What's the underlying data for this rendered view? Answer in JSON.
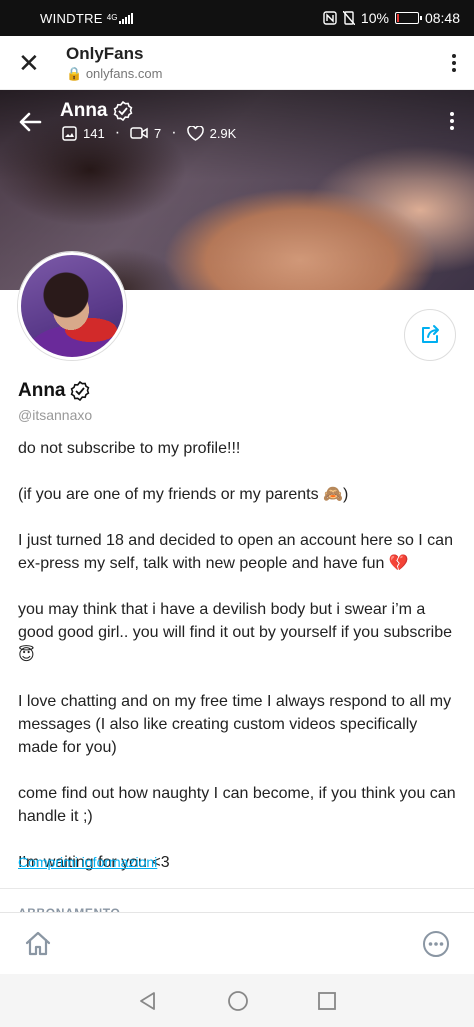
{
  "status_bar": {
    "carrier": "WINDTRE",
    "network": "4G",
    "battery": "10%",
    "battery_level": 0.1,
    "time": "08:48"
  },
  "browser": {
    "title": "OnlyFans",
    "url": "onlyfans.com",
    "close_icon": "close-icon",
    "menu_icon": "more-vert-icon"
  },
  "cover": {
    "name": "Anna",
    "photos_count": "141",
    "videos_count": "7",
    "likes_count": "2.9K"
  },
  "profile": {
    "name": "Anna",
    "handle": "@itsannaxo",
    "bio": [
      "do not subscribe to my profile!!!",
      "(if you are one of my friends or my parents 🙈)",
      "I just turned 18 and decided to open an account here so I can ex-press my self, talk with new people and have fun 💔",
      "you may think that i have a devilish body but i swear i’m a good good girl.. you will find it out by yourself if you subscribe 😇",
      "I love chatting and on my free time I always respond to all my messages (I also like creating custom videos specifically made for you)",
      "come find out how naughty I can become, if you think you can handle it ;)",
      "I’m waiting for you <3"
    ],
    "collapse_link": "Comprimi informazioni",
    "next_section": "ABBONAMENTO"
  },
  "colors": {
    "accent": "#00aff0",
    "muted": "#8a96a3"
  }
}
